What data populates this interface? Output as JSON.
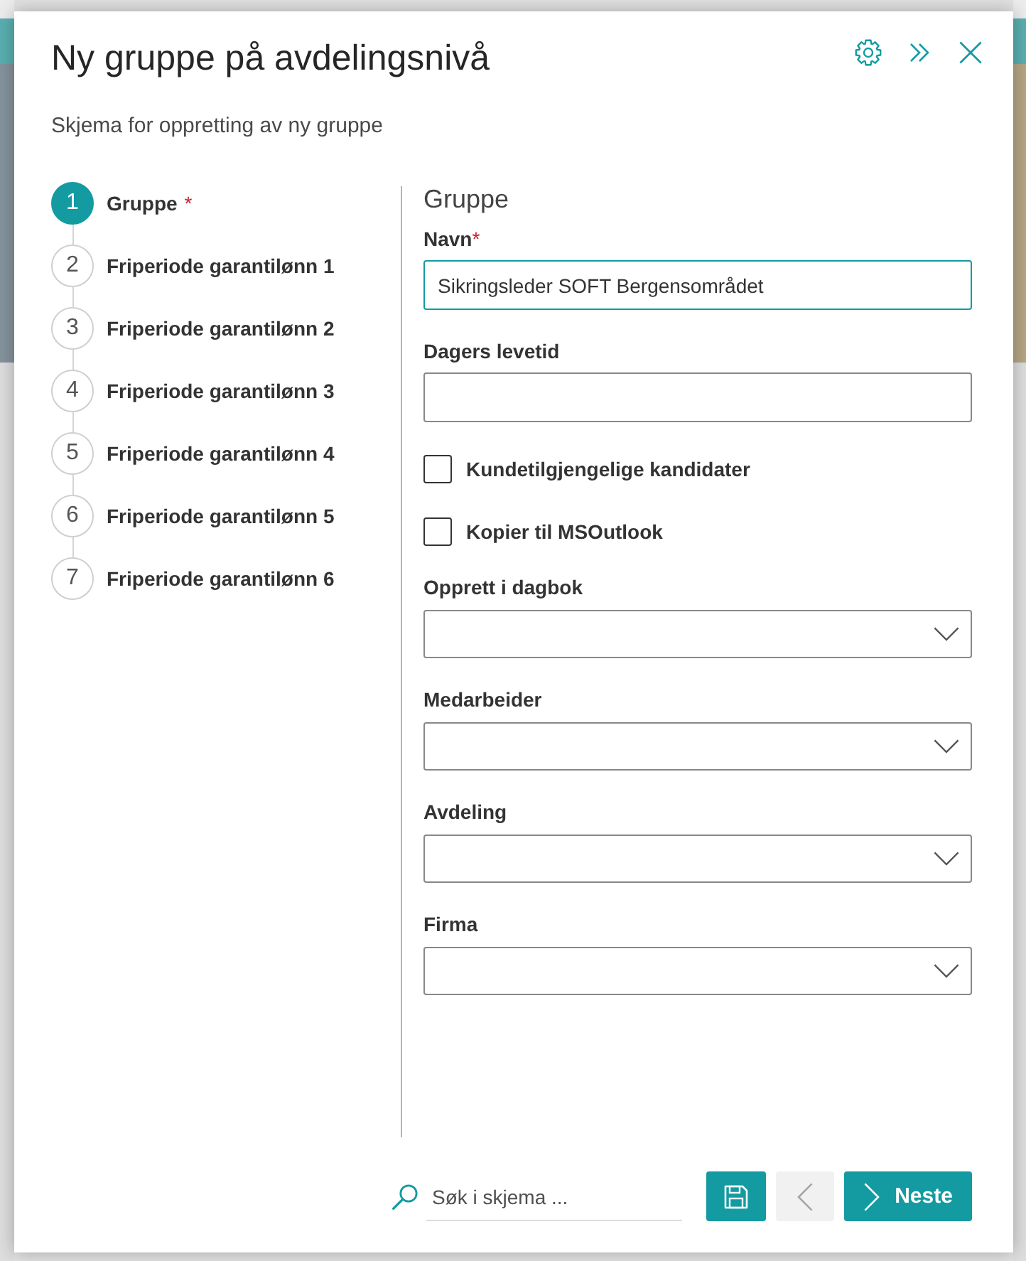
{
  "dialog": {
    "title": "Ny gruppe på avdelingsnivå",
    "subtitle": "Skjema for oppretting av ny gruppe"
  },
  "steps": [
    {
      "number": "1",
      "label": "Gruppe",
      "required_mark": "*",
      "selected": true
    },
    {
      "number": "2",
      "label": "Friperiode garantilønn 1",
      "selected": false
    },
    {
      "number": "3",
      "label": "Friperiode garantilønn 2",
      "selected": false
    },
    {
      "number": "4",
      "label": "Friperiode garantilønn 3",
      "selected": false
    },
    {
      "number": "5",
      "label": "Friperiode garantilønn 4",
      "selected": false
    },
    {
      "number": "6",
      "label": "Friperiode garantilønn 5",
      "selected": false
    },
    {
      "number": "7",
      "label": "Friperiode garantilønn 6",
      "selected": false
    }
  ],
  "section": {
    "title": "Gruppe",
    "fields": [
      {
        "kind": "text",
        "label": "Navn",
        "required_mark": "*",
        "value": "Sikringsleder SOFT Bergensområdet",
        "focused": true
      },
      {
        "kind": "text",
        "label": "Dagers levetid",
        "focused": false
      },
      {
        "kind": "checkbox",
        "label": "Kundetilgjengelige kandidater",
        "checked": false
      },
      {
        "kind": "checkbox",
        "label": "Kopier til MSOutlook",
        "checked": false
      },
      {
        "kind": "dropdown",
        "label": "Opprett i dagbok"
      },
      {
        "kind": "dropdown",
        "label": "Medarbeider"
      },
      {
        "kind": "dropdown",
        "label": "Avdeling"
      },
      {
        "kind": "dropdown",
        "label": "Firma"
      }
    ]
  },
  "footer": {
    "search": {
      "placeholder": "Søk i skjema ..."
    },
    "buttons": [
      {
        "kind": "save",
        "disabled": false
      },
      {
        "kind": "back",
        "disabled": true
      },
      {
        "kind": "next",
        "label": "Neste",
        "disabled": false
      }
    ]
  }
}
